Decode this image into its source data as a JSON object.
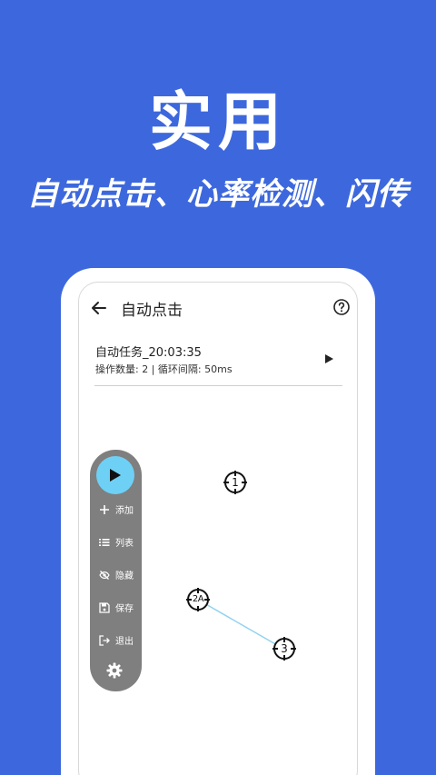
{
  "hero": {
    "title": "实用",
    "subtitle": "自动点击、心率检测、闪传"
  },
  "appbar": {
    "title": "自动点击",
    "back_icon": "arrow-left-icon",
    "help_icon": "help-circle-icon"
  },
  "task": {
    "name": "自动任务_20:03:35",
    "detail": "操作数量: 2 | 循环间隔: 50ms",
    "play_icon": "play-icon"
  },
  "toolbar": {
    "run_icon": "play-icon",
    "items": [
      {
        "label": "添加",
        "icon": "plus-icon"
      },
      {
        "label": "列表",
        "icon": "list-icon"
      },
      {
        "label": "隐藏",
        "icon": "eye-off-icon"
      },
      {
        "label": "保存",
        "icon": "save-icon"
      },
      {
        "label": "退出",
        "icon": "exit-icon"
      }
    ],
    "settings_icon": "gear-icon"
  },
  "markers": [
    {
      "label": "1"
    },
    {
      "label": "2A"
    },
    {
      "label": "3"
    }
  ],
  "colors": {
    "background": "#3d68dd",
    "run_button": "#6fd0f5",
    "toolbar": "#7f7f7f",
    "link_line": "#8fd3ee"
  }
}
